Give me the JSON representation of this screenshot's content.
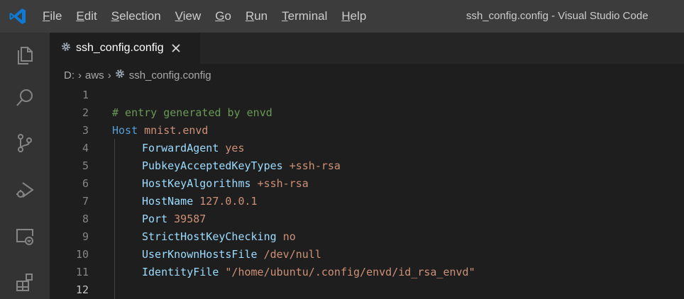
{
  "window": {
    "title": "ssh_config.config - Visual Studio Code"
  },
  "menu": [
    {
      "mnemonic": "F",
      "rest": "ile"
    },
    {
      "mnemonic": "E",
      "rest": "dit"
    },
    {
      "mnemonic": "S",
      "rest": "election"
    },
    {
      "mnemonic": "V",
      "rest": "iew"
    },
    {
      "mnemonic": "G",
      "rest": "o"
    },
    {
      "mnemonic": "R",
      "rest": "un"
    },
    {
      "mnemonic": "T",
      "rest": "erminal"
    },
    {
      "mnemonic": "H",
      "rest": "elp"
    }
  ],
  "activity_bar": {
    "items": [
      {
        "icon": "explorer-icon"
      },
      {
        "icon": "search-icon"
      },
      {
        "icon": "source-control-icon"
      },
      {
        "icon": "run-debug-icon"
      },
      {
        "icon": "remote-explorer-icon"
      },
      {
        "icon": "extensions-icon"
      }
    ]
  },
  "tab": {
    "label": "ssh_config.config",
    "icon": "gear-icon",
    "close_glyph": "✕"
  },
  "breadcrumb": {
    "drive": "D:",
    "folder": "aws",
    "file": "ssh_config.config",
    "separator": "›"
  },
  "editor": {
    "active_line": 12,
    "lines": [
      {
        "n": "1",
        "key": "",
        "val": ""
      },
      {
        "n": "2",
        "comment": "# entry generated by envd"
      },
      {
        "n": "3",
        "keyword": "Host",
        "val": "mnist.envd"
      },
      {
        "n": "4",
        "key": "ForwardAgent",
        "val": "yes"
      },
      {
        "n": "5",
        "key": "PubkeyAcceptedKeyTypes",
        "val": "+ssh-rsa"
      },
      {
        "n": "6",
        "key": "HostKeyAlgorithms",
        "val": "+ssh-rsa"
      },
      {
        "n": "7",
        "key": "HostName",
        "val": "127.0.0.1"
      },
      {
        "n": "8",
        "key": "Port",
        "val": "39587"
      },
      {
        "n": "9",
        "key": "StrictHostKeyChecking",
        "val": "no"
      },
      {
        "n": "10",
        "key": "UserKnownHostsFile",
        "val": "/dev/null"
      },
      {
        "n": "11",
        "key": "IdentityFile",
        "val": "\"/home/ubuntu/.config/envd/id_rsa_envd\""
      },
      {
        "n": "12",
        "key": "",
        "val": ""
      }
    ]
  },
  "colors": {
    "logo": "#0e7ad4",
    "comment": "#6a9955",
    "keyword": "#569cd6",
    "key": "#9cdcfe",
    "value": "#ce9178"
  }
}
